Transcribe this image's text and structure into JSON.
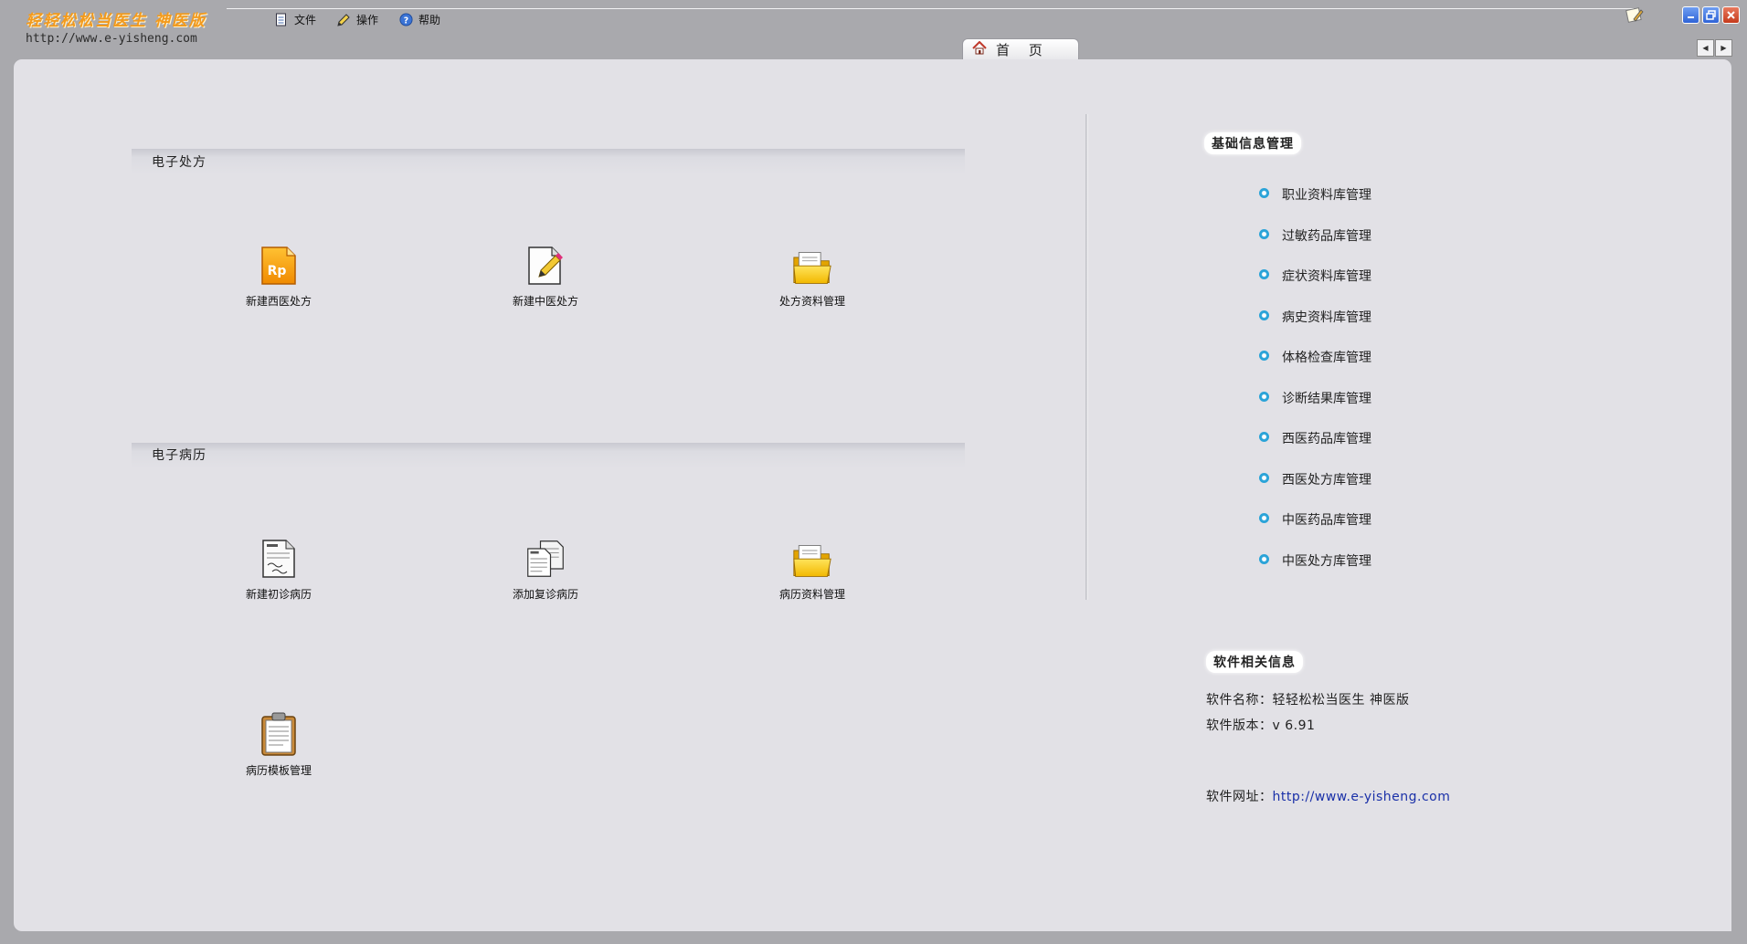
{
  "app": {
    "logo_title": "轻轻松松当医生 神医版",
    "logo_url": "http://www.e-yisheng.com"
  },
  "menu": {
    "items": [
      {
        "label": "文件",
        "icon": "document-icon"
      },
      {
        "label": "操作",
        "icon": "pencil-icon"
      },
      {
        "label": "帮助",
        "icon": "help-icon"
      }
    ]
  },
  "tabs": [
    {
      "label": "首 页",
      "icon": "home-icon",
      "active": true
    }
  ],
  "prescription": {
    "section_title": "电子处方",
    "items": [
      {
        "label": "新建西医处方",
        "icon": "rp-prescription-icon"
      },
      {
        "label": "新建中医处方",
        "icon": "edit-document-icon"
      },
      {
        "label": "处方资料管理",
        "icon": "folder-icon"
      }
    ]
  },
  "medical_record": {
    "section_title": "电子病历",
    "items": [
      {
        "label": "新建初诊病历",
        "icon": "record-document-icon"
      },
      {
        "label": "添加复诊病历",
        "icon": "copy-documents-icon"
      },
      {
        "label": "病历资料管理",
        "icon": "folder-icon"
      },
      {
        "label": "病历模板管理",
        "icon": "clipboard-icon"
      }
    ]
  },
  "basic_info": {
    "heading": "基础信息管理",
    "items": [
      "职业资料库管理",
      "过敏药品库管理",
      "症状资料库管理",
      "病史资料库管理",
      "体格检查库管理",
      "诊断结果库管理",
      "西医药品库管理",
      "西医处方库管理",
      "中医药品库管理",
      "中医处方库管理"
    ]
  },
  "software_info": {
    "heading": "软件相关信息",
    "name_label": "软件名称：",
    "name_value": "轻轻松松当医生 神医版",
    "version_label": "软件版本：",
    "version_value": "v 6.91",
    "site_label": "软件网址：",
    "site_value": "http://www.e-yisheng.com"
  },
  "colors": {
    "background": "#a9a9ad",
    "panel": "#e2e1e6",
    "logo_orange": "#f39a1c",
    "link_blue": "#1a30a8",
    "bullet_blue": "#2aa3d8"
  }
}
